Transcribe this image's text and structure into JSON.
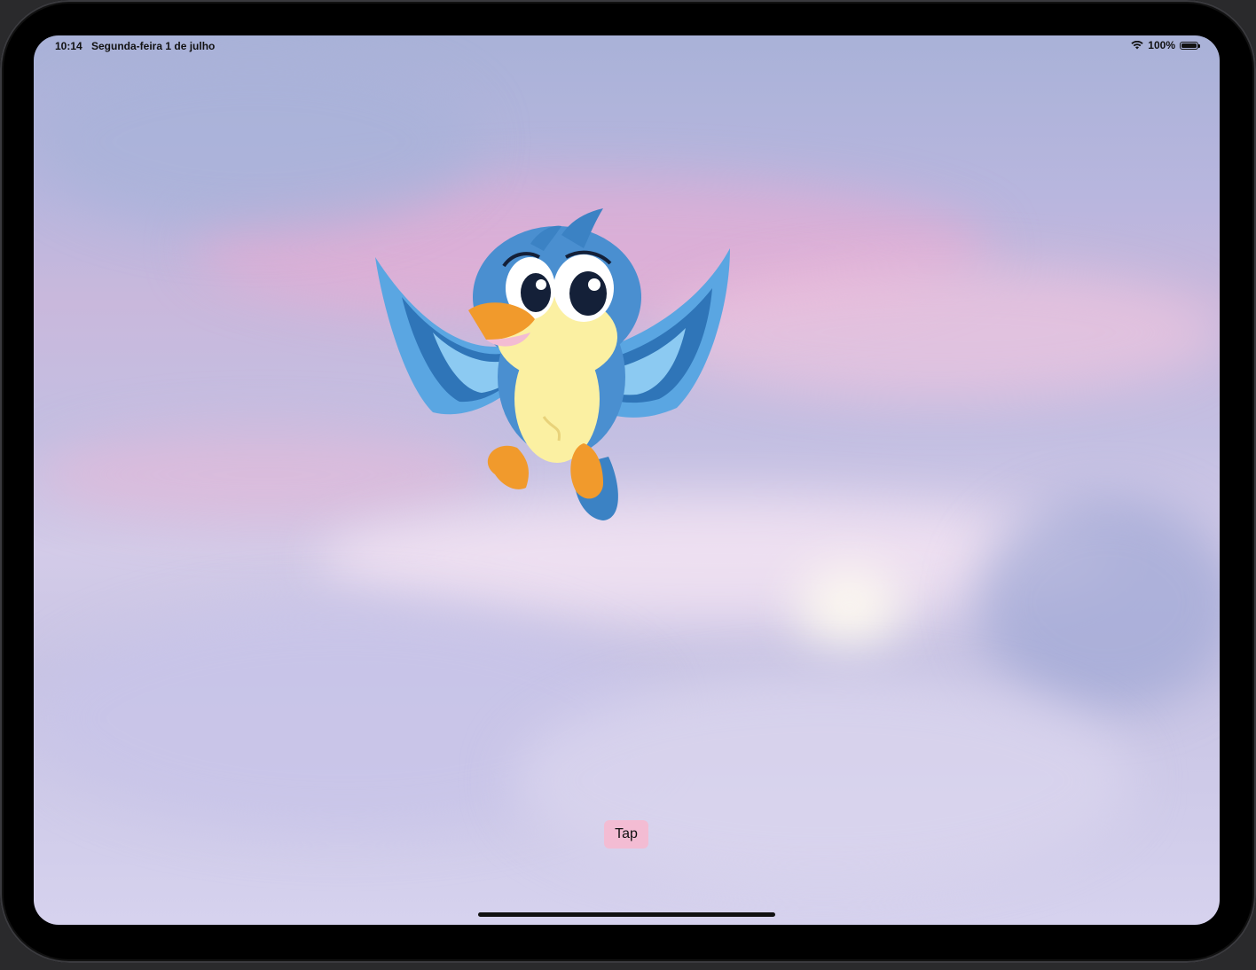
{
  "status_bar": {
    "time": "10:14",
    "date": "Segunda-feira 1 de julho",
    "battery_text": "100%",
    "battery_level": 1.0,
    "icons": [
      "wifi-icon",
      "battery-icon"
    ]
  },
  "main": {
    "character": "bird-illustration",
    "tap_button_label": "Tap"
  },
  "colors": {
    "tap_button": "#f3bcd3",
    "bird_body": "#4a8fd0",
    "bird_belly": "#fbf0a2",
    "bird_beak": "#f19a2c"
  }
}
